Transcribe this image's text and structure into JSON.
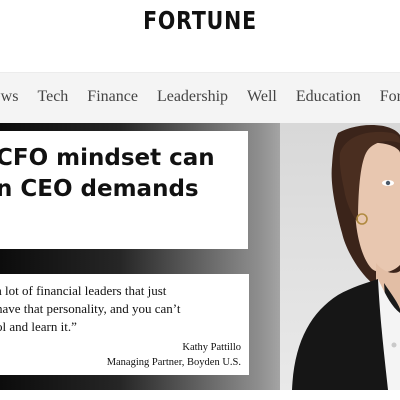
{
  "site": {
    "logo_text": "FORTUNE"
  },
  "nav": {
    "items": [
      {
        "label": "News"
      },
      {
        "label": "Tech"
      },
      {
        "label": "Finance"
      },
      {
        "label": "Leadership"
      },
      {
        "label": "Well"
      },
      {
        "label": "Education"
      },
      {
        "label": "Fortune"
      }
    ]
  },
  "hero": {
    "headline_line1": "CFO mindset can",
    "headline_line2": "n CEO demands",
    "quote_line1": "a lot of financial leaders that just",
    "quote_line2": "have that personality, and you can’t",
    "quote_line3": "ol and learn it.”",
    "attribution_name": "Kathy Pattillo",
    "attribution_title": "Managing Partner, Boyden U.S."
  },
  "colors": {
    "background": "#ffffff",
    "nav_background": "#f4f4f4",
    "nav_text": "#444444",
    "logo": "#111111"
  }
}
